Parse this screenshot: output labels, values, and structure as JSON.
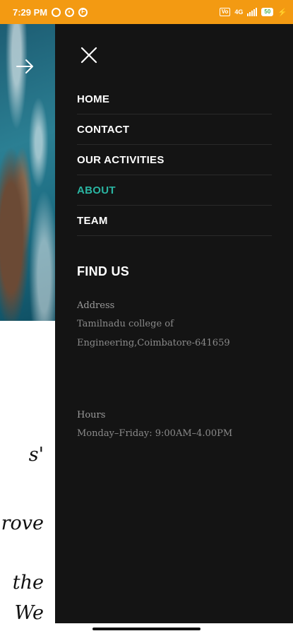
{
  "status_bar": {
    "time": "7:29 PM",
    "network_label": "4G",
    "volte_label": "Vo",
    "battery": "50"
  },
  "background_page": {
    "text_lines": [
      "s'",
      "rove",
      "the",
      "We"
    ]
  },
  "drawer": {
    "nav_items": [
      {
        "label": "HOME"
      },
      {
        "label": "CONTACT"
      },
      {
        "label": "OUR ACTIVITIES"
      },
      {
        "label": "ABOUT",
        "active": true
      },
      {
        "label": "TEAM"
      }
    ],
    "find_us_title": "FIND US",
    "address_label": "Address",
    "address_text": "Tamilnadu college of Engineering,Coimbatore-641659",
    "hours_label": "Hours",
    "hours_text": "Monday–Friday: 9:00AM–4.00PM"
  },
  "colors": {
    "status_bar": "#f39a12",
    "drawer_bg": "#141414",
    "active_link": "#2ab5a2"
  }
}
